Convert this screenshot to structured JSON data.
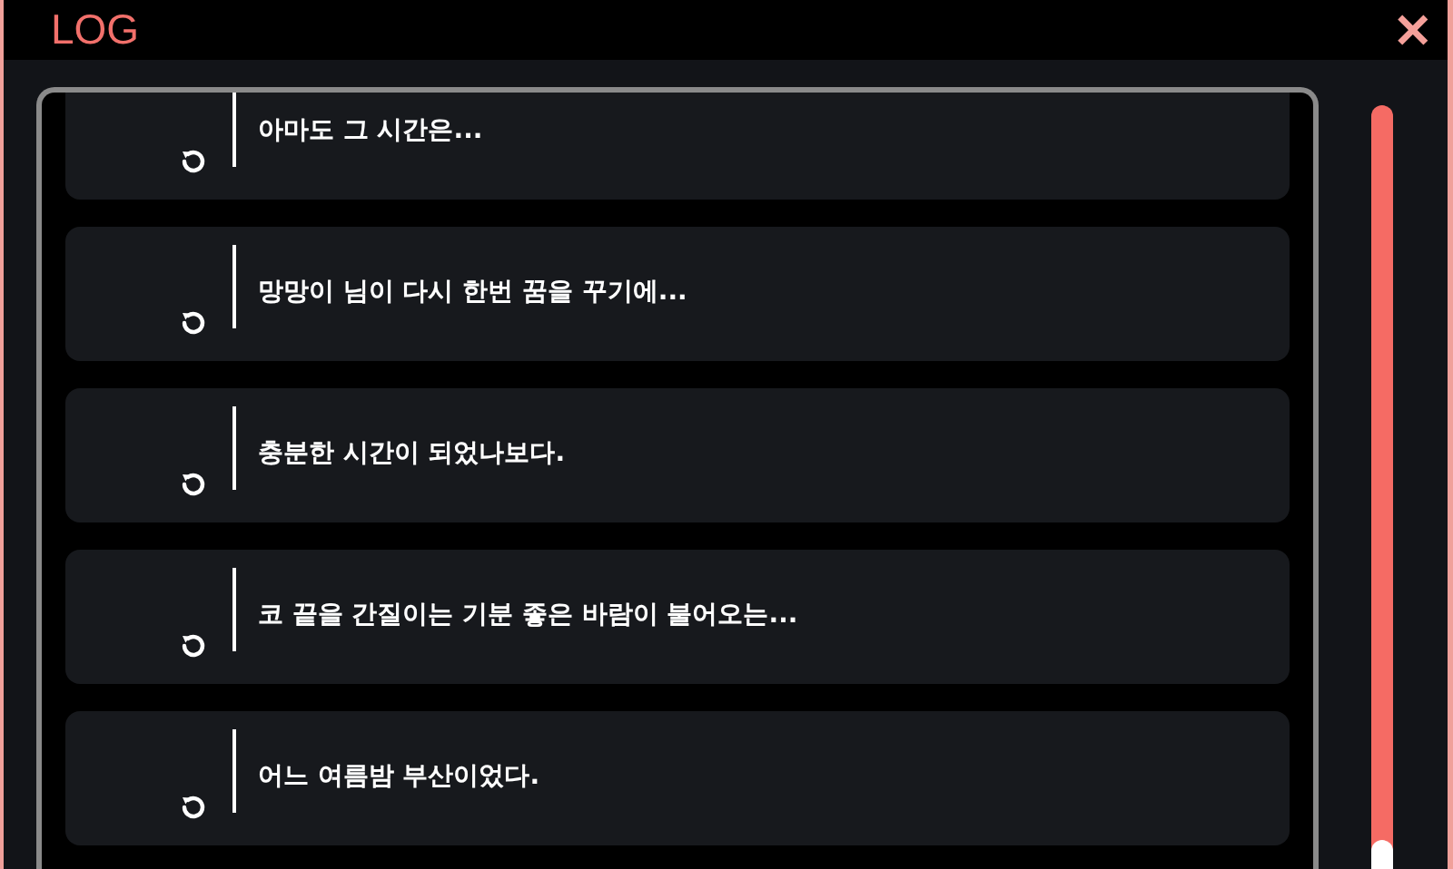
{
  "window": {
    "title": "LOG",
    "close": "✕"
  },
  "log": [
    {
      "text": "아마도 그 시간은..."
    },
    {
      "text": "망망이 님이 다시 한번 꿈을 꾸기에..."
    },
    {
      "text": "충분한 시간이 되었나보다."
    },
    {
      "text": "코 끝을 간질이는 기분 좋은 바람이 불어오는..."
    },
    {
      "text": "어느 여름밤 부산이었다."
    }
  ]
}
